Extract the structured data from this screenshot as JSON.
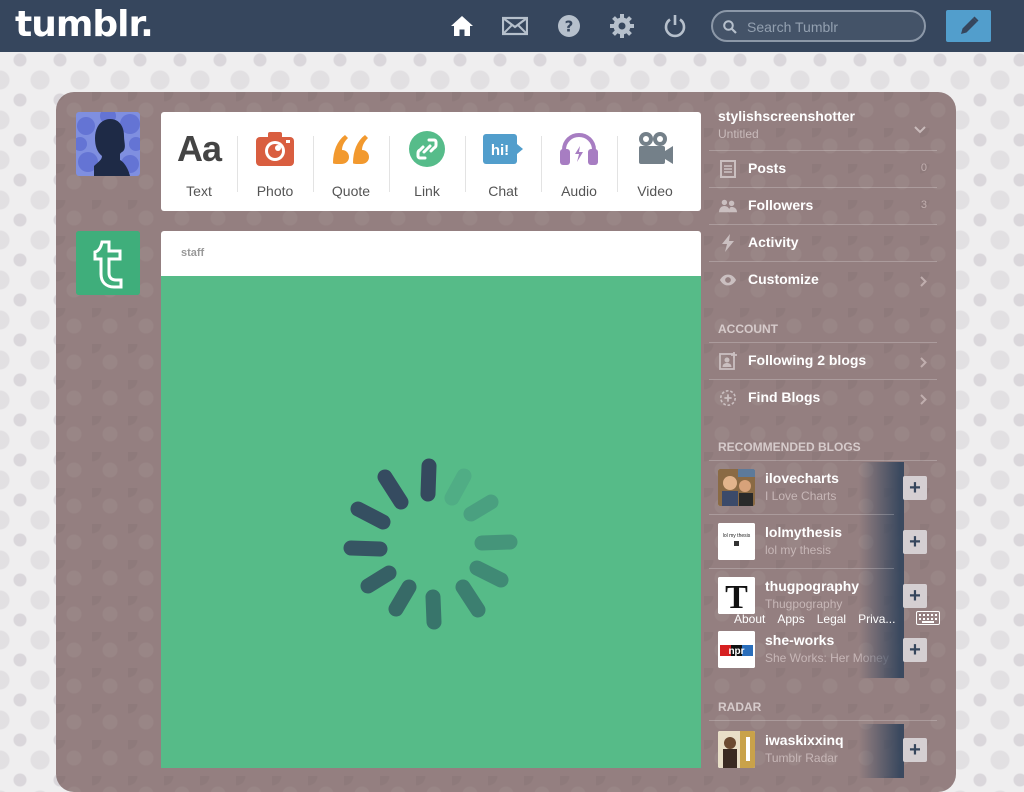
{
  "header": {
    "logo": "tumblr.",
    "search_placeholder": "Search Tumblr",
    "icons": [
      "home-icon",
      "mail-icon",
      "help-icon",
      "settings-icon",
      "power-icon"
    ],
    "compose_icon": "pencil-icon"
  },
  "post_types": [
    {
      "label": "Text",
      "glyph": "Aa",
      "color": "#444444"
    },
    {
      "label": "Photo",
      "color": "#d95e40"
    },
    {
      "label": "Quote",
      "color": "#f2992e"
    },
    {
      "label": "Link",
      "color": "#56bc8a"
    },
    {
      "label": "Chat",
      "color": "#529ecc"
    },
    {
      "label": "Audio",
      "color": "#a77dc2"
    },
    {
      "label": "Video",
      "color": "#748089"
    }
  ],
  "post": {
    "blog_name": "staff",
    "body_color": "#56bb88",
    "loading": true
  },
  "sidebar": {
    "account_name": "stylishscreenshotter",
    "account_subtitle": "Untitled",
    "items": [
      {
        "label": "Posts",
        "count": "0",
        "icon": "posts-icon"
      },
      {
        "label": "Followers",
        "count": "3",
        "icon": "followers-icon"
      },
      {
        "label": "Activity",
        "icon": "activity-icon"
      },
      {
        "label": "Customize",
        "icon": "eye-icon"
      }
    ],
    "account_title": "ACCOUNT",
    "account_items": [
      {
        "label": "Following 2 blogs",
        "icon": "following-icon"
      },
      {
        "label": "Find Blogs",
        "icon": "find-blogs-icon"
      }
    ],
    "recommended_title": "RECOMMENDED BLOGS",
    "recommended": [
      {
        "name": "ilovecharts",
        "title": "I Love Charts"
      },
      {
        "name": "lolmythesis",
        "title": "lol my thesis",
        "avatar_text": "lol my thesis"
      },
      {
        "name": "thugpography",
        "title": "Thugpography",
        "avatar_text": "T"
      },
      {
        "name": "she-works",
        "title": "She Works: Her Money",
        "avatar_text": "npr"
      }
    ],
    "radar_title": "RADAR",
    "radar": {
      "name": "iwaskixxinq",
      "title": "Tumblr Radar"
    }
  },
  "footer": {
    "links": [
      "About",
      "Apps",
      "Legal",
      "Priva..."
    ]
  },
  "colors": {
    "header_bg": "#36465d",
    "dashboard_bg": "#947f80",
    "compose_bg": "#529ecc"
  }
}
